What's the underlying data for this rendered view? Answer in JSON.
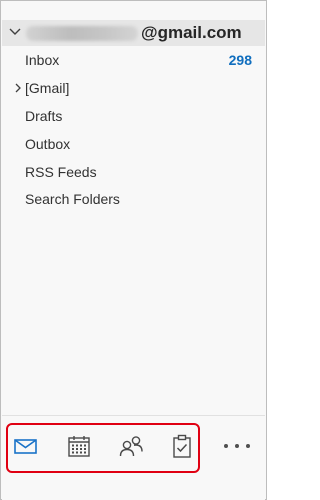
{
  "account": {
    "email_domain": "@gmail.com"
  },
  "folders": [
    {
      "label": "Inbox",
      "count": "298"
    },
    {
      "label": "[Gmail]"
    },
    {
      "label": "Drafts"
    },
    {
      "label": "Outbox"
    },
    {
      "label": "RSS Feeds"
    },
    {
      "label": "Search Folders"
    }
  ],
  "navbar": {
    "items": [
      {
        "icon": "mail-icon",
        "active": true
      },
      {
        "icon": "calendar-icon"
      },
      {
        "icon": "people-icon"
      },
      {
        "icon": "tasks-icon"
      },
      {
        "icon": "more-icon"
      }
    ],
    "highlight_color": "#e00012"
  },
  "colors": {
    "accent": "#106ebe",
    "header_bg": "#e6e6e6",
    "pane_bg": "#f8f8f8"
  }
}
